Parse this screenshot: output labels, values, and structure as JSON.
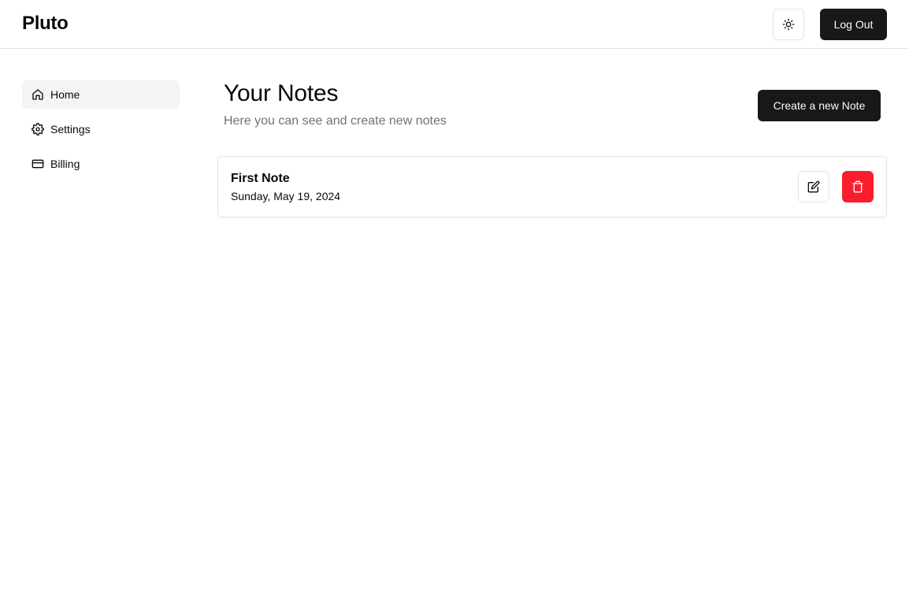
{
  "header": {
    "brand": "Pluto",
    "theme_icon": "sun-icon",
    "logout_label": "Log Out"
  },
  "sidebar": {
    "items": [
      {
        "label": "Home",
        "icon": "home-icon",
        "active": true
      },
      {
        "label": "Settings",
        "icon": "gear-icon",
        "active": false
      },
      {
        "label": "Billing",
        "icon": "credit-card-icon",
        "active": false
      }
    ]
  },
  "main": {
    "title": "Your Notes",
    "subtitle": "Here you can see and create new notes",
    "create_label": "Create a new Note",
    "notes": [
      {
        "title": "First Note",
        "date": "Sunday, May 19, 2024",
        "edit_icon": "edit-icon",
        "delete_icon": "trash-icon"
      }
    ]
  },
  "colors": {
    "primary": "#18181b",
    "destructive": "#fa1e2d",
    "border": "#e4e4e7",
    "muted_text": "#71717a",
    "active_nav_bg": "#f4f4f5"
  }
}
